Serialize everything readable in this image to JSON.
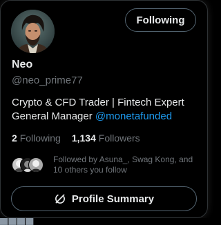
{
  "profile": {
    "name": "Neo",
    "handle": "@neo_prime77",
    "bio_text": "Crypto & CFD Trader | Fintech Expert General Manager ",
    "bio_mention": "@monetafunded",
    "following_count": "2",
    "following_label": "Following",
    "followers_count": "1,134",
    "followers_label": "Followers",
    "followed_by": "Followed by Asuna_, Swag Kong, and 10 others you follow"
  },
  "actions": {
    "follow_button": "Following",
    "summary_button": "Profile Summary"
  },
  "colors": {
    "accent": "#1d9bf0",
    "secondary_text": "#71767b",
    "border": "#536471"
  },
  "icons": {
    "summary": "grok-slash-icon"
  }
}
